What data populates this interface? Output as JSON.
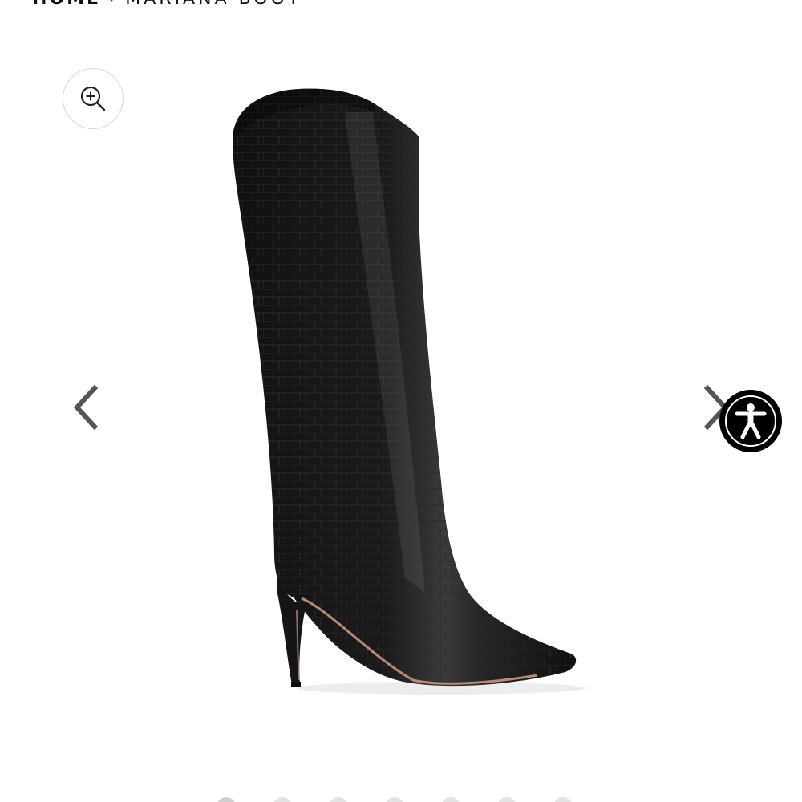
{
  "breadcrumb": {
    "home_label": "HOME",
    "separator": "›",
    "current_label": "MARIANA BOOT"
  },
  "zoom": {
    "icon": "zoom-in-icon"
  },
  "carousel": {
    "prev_icon": "chevron-left-icon",
    "next_icon": "chevron-right-icon",
    "slide_count": 7,
    "active_index": 0
  },
  "accessibility": {
    "icon": "accessibility-person-icon"
  },
  "colors": {
    "boot": "#141414",
    "highlight": "#4a4a4a",
    "heel_sole": "#c99580",
    "arrow": "#555555",
    "widget": "#000000"
  }
}
